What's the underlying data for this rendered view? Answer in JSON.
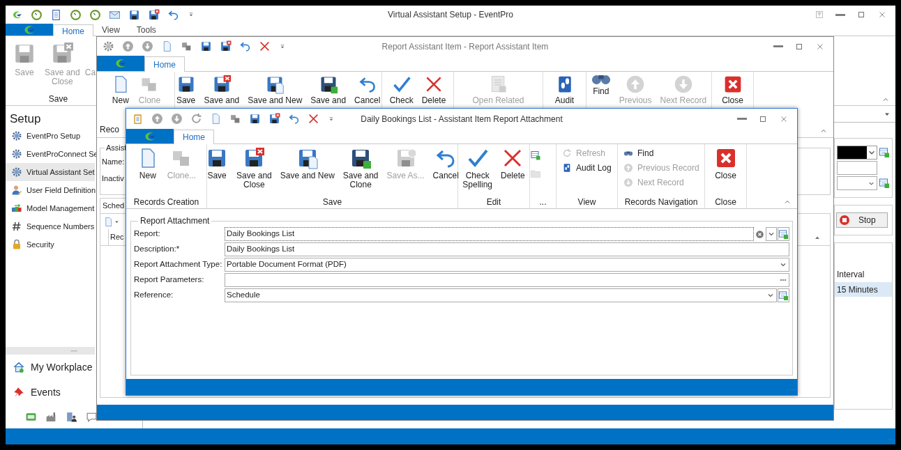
{
  "main_window": {
    "title": "Virtual Assistant Setup - EventPro",
    "tabs": [
      {
        "label": "Home",
        "selected": true
      },
      {
        "label": "View",
        "selected": false
      },
      {
        "label": "Tools",
        "selected": false
      }
    ],
    "ribbon": {
      "group_label": "Save",
      "buttons": [
        {
          "label": "Save",
          "disabled": true
        },
        {
          "label": "Save and\nClose",
          "disabled": true
        },
        {
          "label": "Ca",
          "disabled": true
        }
      ]
    },
    "sidebar": {
      "title": "Setup",
      "items": [
        {
          "label": "EventPro Setup",
          "selected": false
        },
        {
          "label": "EventProConnect Se",
          "selected": false
        },
        {
          "label": "Virtual Assistant Set",
          "selected": true
        },
        {
          "label": "User Field Definition",
          "selected": false
        },
        {
          "label": "Model Management",
          "selected": false
        },
        {
          "label": "Sequence Numbers",
          "selected": false
        },
        {
          "label": "Security",
          "selected": false
        }
      ],
      "nav": [
        {
          "label": "My Workplace"
        },
        {
          "label": "Events"
        }
      ]
    },
    "details": {
      "stop_button": "Stop",
      "grid_column": "Interval",
      "grid_row": "15 Minutes"
    }
  },
  "record_window": {
    "title": "Report Assistant Item - Report Assistant Item",
    "tabs": [
      {
        "label": "Home",
        "selected": true
      }
    ],
    "ribbon": {
      "groups": [
        {
          "label": "Reco",
          "buttons": [
            {
              "label": "New",
              "disabled": false
            },
            {
              "label": "Clone",
              "disabled": true
            }
          ]
        },
        {
          "buttons": [
            {
              "label": "Save",
              "disabled": false
            },
            {
              "label": "Save and",
              "disabled": false
            },
            {
              "label": "Save and New",
              "disabled": false
            },
            {
              "label": "Save and",
              "disabled": false
            },
            {
              "label": "Cancel",
              "disabled": false
            }
          ]
        },
        {
          "buttons": [
            {
              "label": "Check",
              "disabled": false
            },
            {
              "label": "Delete",
              "disabled": false
            }
          ]
        },
        {
          "buttons": [
            {
              "label": "Open Related",
              "disabled": true
            }
          ]
        },
        {
          "buttons": [
            {
              "label": "Audit",
              "disabled": false
            }
          ]
        },
        {
          "buttons": [
            {
              "label": "Find",
              "disabled": false
            },
            {
              "label": "Previous",
              "disabled": true
            },
            {
              "label": "Next Record",
              "disabled": true
            }
          ]
        },
        {
          "buttons": [
            {
              "label": "Close",
              "disabled": false
            }
          ]
        }
      ]
    },
    "form": {
      "group_label": "Assist",
      "labels": [
        "Name:",
        "Inactiv"
      ],
      "tab": "Sched",
      "column": "Rec"
    }
  },
  "attachment_window": {
    "title": "Daily Bookings List - Assistant Item Report Attachment",
    "tabs": [
      {
        "label": "Home",
        "selected": true
      }
    ],
    "ribbon": {
      "groups": [
        {
          "label": "Records Creation",
          "buttons": [
            {
              "kind": "large",
              "label": "New",
              "disabled": false
            },
            {
              "kind": "large",
              "label": "Clone...",
              "disabled": true
            }
          ]
        },
        {
          "label": "Save",
          "buttons": [
            {
              "kind": "large",
              "label": "Save",
              "disabled": false
            },
            {
              "kind": "large",
              "label": "Save and\nClose",
              "disabled": false
            },
            {
              "kind": "large",
              "label": "Save and New",
              "disabled": false
            },
            {
              "kind": "large",
              "label": "Save and\nClone",
              "disabled": false
            },
            {
              "kind": "large",
              "label": "Save As...",
              "disabled": true
            },
            {
              "kind": "large",
              "label": "Cancel",
              "disabled": false
            }
          ]
        },
        {
          "label": "Edit",
          "buttons": [
            {
              "kind": "large",
              "label": "Check\nSpelling",
              "disabled": false
            },
            {
              "kind": "large",
              "label": "Delete",
              "disabled": false
            }
          ]
        },
        {
          "label": "...",
          "buttons": [
            {
              "kind": "icon",
              "disabled": false
            },
            {
              "kind": "icon",
              "disabled": true
            }
          ]
        },
        {
          "label": "View",
          "buttons": [
            {
              "kind": "small",
              "label": "Refresh",
              "disabled": true
            },
            {
              "kind": "small",
              "label": "Audit Log",
              "disabled": false
            }
          ]
        },
        {
          "label": "Records Navigation",
          "buttons": [
            {
              "kind": "small",
              "label": "Find",
              "disabled": false
            },
            {
              "kind": "small",
              "label": "Previous Record",
              "disabled": true
            },
            {
              "kind": "small",
              "label": "Next Record",
              "disabled": true
            }
          ]
        },
        {
          "label": "Close",
          "buttons": [
            {
              "kind": "large",
              "label": "Close",
              "disabled": false
            }
          ]
        }
      ]
    },
    "form": {
      "legend": "Report Attachment",
      "fields": [
        {
          "label": "Report:",
          "value": "Daily Bookings List",
          "kind": "clearable",
          "focused": true
        },
        {
          "label": "Description:*",
          "value": "Daily Bookings List",
          "kind": "text",
          "focused": false
        },
        {
          "label": "Report Attachment Type:",
          "value": "Portable Document Format (PDF)",
          "kind": "dropdown",
          "focused": false
        },
        {
          "label": "Report Parameters:",
          "kind": "ellipsis",
          "focused": false
        },
        {
          "label": "Reference:",
          "value": "Schedule",
          "kind": "lookup",
          "focused": false
        }
      ]
    }
  }
}
